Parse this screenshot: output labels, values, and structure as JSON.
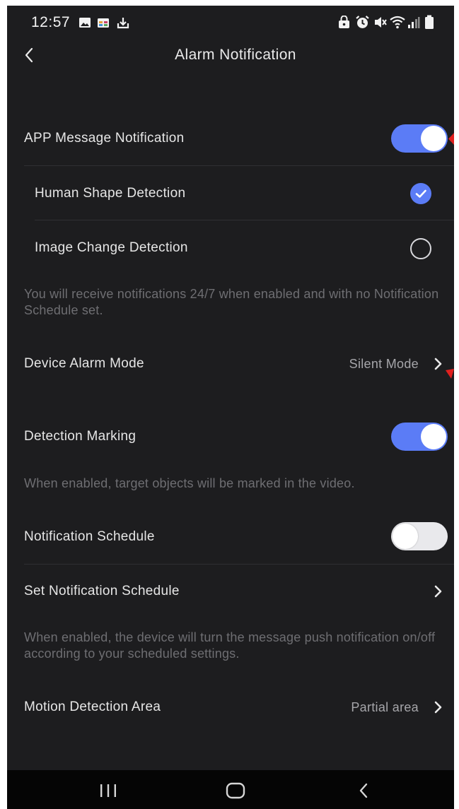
{
  "status_bar": {
    "time": "12:57"
  },
  "header": {
    "title": "Alarm Notification"
  },
  "settings": {
    "app_message_notification": {
      "label": "APP Message Notification",
      "enabled": true
    },
    "human_shape_detection": {
      "label": "Human Shape Detection",
      "checked": true
    },
    "image_change_detection": {
      "label": "Image Change Detection",
      "checked": false
    },
    "notification_help": "You will receive notifications 24/7 when enabled and with no Notification Schedule set.",
    "device_alarm_mode": {
      "label": "Device Alarm Mode",
      "value": "Silent Mode"
    },
    "detection_marking": {
      "label": "Detection Marking",
      "enabled": true
    },
    "detection_marking_help": "When enabled, target objects will be marked in the video.",
    "notification_schedule": {
      "label": "Notification Schedule",
      "enabled": false
    },
    "set_notification_schedule": {
      "label": "Set Notification Schedule"
    },
    "schedule_help": "When enabled, the device will turn the message push notification on/off according to your scheduled settings.",
    "motion_detection_area": {
      "label": "Motion Detection Area",
      "value": "Partial area"
    }
  },
  "colors": {
    "background": "#1d1d1f",
    "accent": "#5b7cf6",
    "annotation_arrow": "#e0201e"
  },
  "icons": {
    "status_left": [
      "gallery-icon",
      "calendar-icon",
      "cloud-download-icon"
    ],
    "status_right": [
      "lock-icon",
      "alarm-clock-icon",
      "mute-icon",
      "wifi-icon",
      "signal-icon",
      "battery-icon"
    ],
    "nav": [
      "recent-apps-icon",
      "home-icon",
      "back-icon"
    ]
  }
}
